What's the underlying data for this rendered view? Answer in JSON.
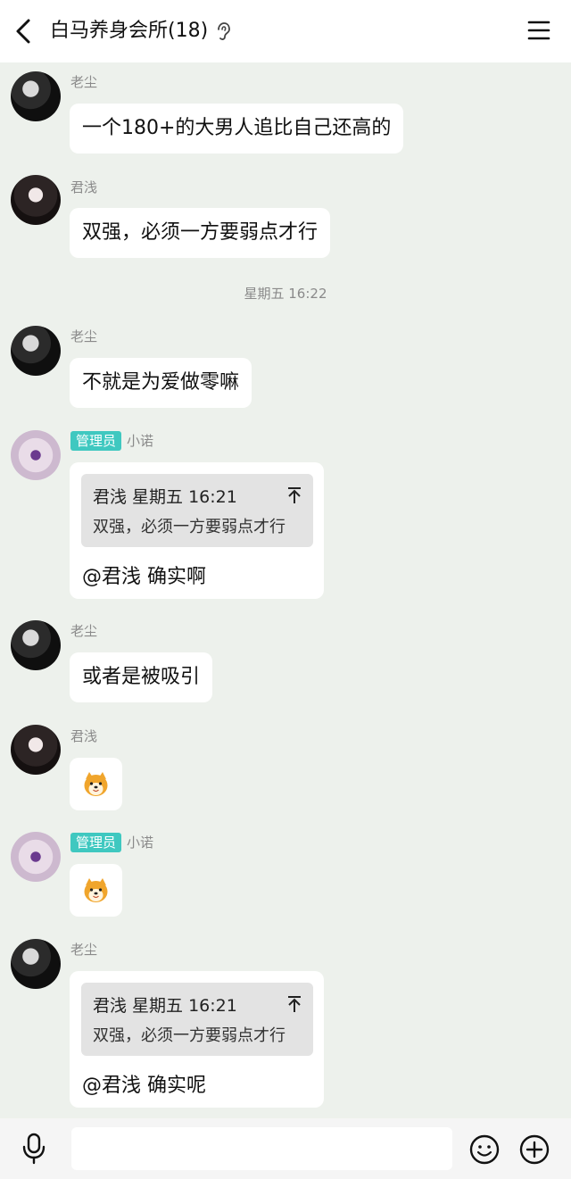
{
  "header": {
    "title": "白马养身会所(18)",
    "back_icon": "back-arrow-icon",
    "ear_icon": "ear-icon",
    "menu_icon": "menu-icon"
  },
  "messages": [
    {
      "type": "text",
      "sender": "老尘",
      "avatar": "laochen",
      "text": "一个180+的大男人追比自己还高的"
    },
    {
      "type": "text",
      "sender": "君浅",
      "avatar": "junqian",
      "text": "双强，必须一方要弱点才行"
    },
    {
      "type": "timestamp",
      "text": "星期五 16:22"
    },
    {
      "type": "text",
      "sender": "老尘",
      "avatar": "laochen",
      "text": "不就是为爱做零嘛"
    },
    {
      "type": "quote",
      "sender": "小诺",
      "badge": "管理员",
      "avatar": "xiaonuo",
      "quote_head": "君浅 星期五 16:21",
      "quote_text": "双强，必须一方要弱点才行",
      "reply": "@君浅 确实啊"
    },
    {
      "type": "text",
      "sender": "老尘",
      "avatar": "laochen",
      "text": "或者是被吸引"
    },
    {
      "type": "sticker",
      "sender": "君浅",
      "avatar": "junqian",
      "sticker": "shiba-dog-sticker"
    },
    {
      "type": "sticker",
      "sender": "小诺",
      "badge": "管理员",
      "avatar": "xiaonuo",
      "sticker": "shiba-dog-sticker"
    },
    {
      "type": "quote",
      "sender": "老尘",
      "avatar": "laochen",
      "quote_head": "君浅 星期五 16:21",
      "quote_text": "双强，必须一方要弱点才行",
      "reply": "@君浅 确实呢"
    }
  ],
  "input": {
    "value": "",
    "placeholder": ""
  },
  "bottom_icons": {
    "voice": "microphone-icon",
    "emoji": "emoji-icon",
    "plus": "plus-icon"
  },
  "colors": {
    "background": "#edf1ec",
    "badge": "#3fc8c0",
    "bubble": "#ffffff",
    "quote_box": "#e3e3e3"
  }
}
